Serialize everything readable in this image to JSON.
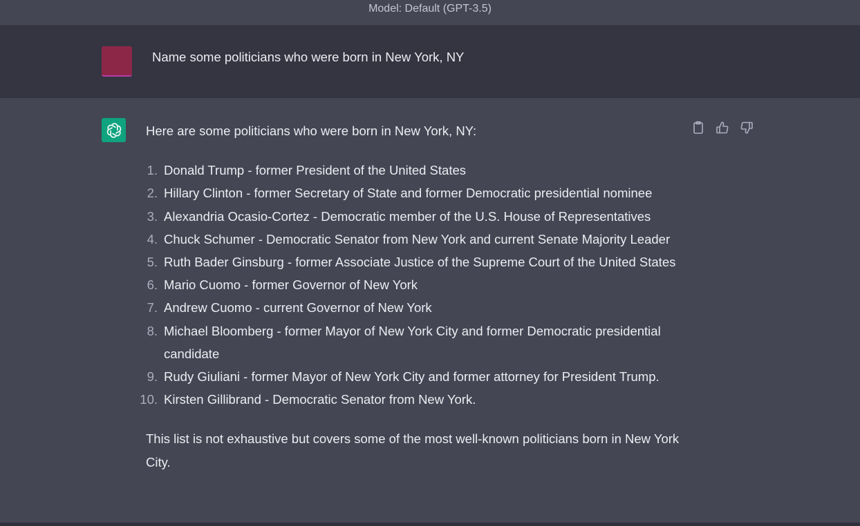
{
  "header": {
    "model_label": "Model: Default (GPT-3.5)"
  },
  "user_message": {
    "text": "Name some politicians who were born in New York, NY",
    "avatar_color": "#8c2748"
  },
  "assistant_message": {
    "intro": "Here are some politicians who were born in New York, NY:",
    "items": [
      {
        "num": "1.",
        "text": "Donald Trump - former President of the United States"
      },
      {
        "num": "2.",
        "text": "Hillary Clinton - former Secretary of State and former Democratic presidential nominee"
      },
      {
        "num": "3.",
        "text": "Alexandria Ocasio-Cortez - Democratic member of the U.S. House of Representatives"
      },
      {
        "num": "4.",
        "text": "Chuck Schumer - Democratic Senator from New York and current Senate Majority Leader"
      },
      {
        "num": "5.",
        "text": "Ruth Bader Ginsburg - former Associate Justice of the Supreme Court of the United States"
      },
      {
        "num": "6.",
        "text": "Mario Cuomo - former Governor of New York"
      },
      {
        "num": "7.",
        "text": "Andrew Cuomo - current Governor of New York"
      },
      {
        "num": "8.",
        "text": "Michael Bloomberg - former Mayor of New York City and former Democratic presidential candidate"
      },
      {
        "num": "9.",
        "text": "Rudy Giuliani - former Mayor of New York City and former attorney for President Trump."
      },
      {
        "num": "10.",
        "text": "Kirsten Gillibrand - Democratic Senator from New York."
      }
    ],
    "outro": "This list is not exhaustive but covers some of the most well-known politicians born in New York City.",
    "avatar_color": "#10a37f"
  },
  "actions": {
    "icons": [
      "clipboard-icon",
      "thumbs-up-icon",
      "thumbs-down-icon"
    ]
  },
  "colors": {
    "user_bg": "#343541",
    "assistant_bg": "#444654",
    "text": "#ececf1"
  }
}
